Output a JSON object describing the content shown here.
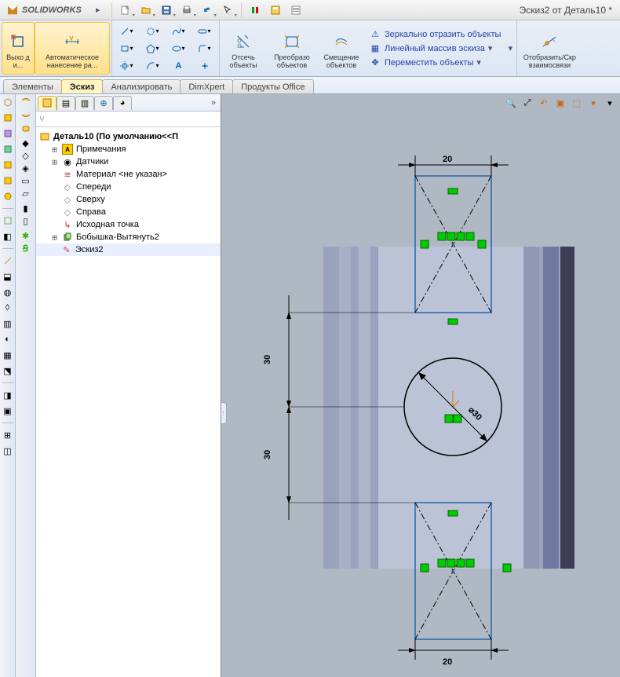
{
  "app": {
    "name": "SOLIDWORKS",
    "doc_title": "Эскиз2 от Деталь10 *"
  },
  "menubar": [
    {
      "id": "new",
      "name": "new-icon"
    },
    {
      "id": "open",
      "name": "open-icon"
    },
    {
      "id": "save",
      "name": "save-icon"
    },
    {
      "id": "print",
      "name": "print-icon"
    },
    {
      "id": "undo",
      "name": "undo-icon"
    },
    {
      "id": "select",
      "name": "select-arrow-icon"
    },
    {
      "id": "rebuild",
      "name": "rebuild-icon"
    },
    {
      "id": "options",
      "name": "options-icon"
    },
    {
      "id": "properties",
      "name": "properties-icon"
    }
  ],
  "ribbon": {
    "exit": {
      "label": "Выхо д и..."
    },
    "smart_dim": {
      "label": "Автоматическое нанесение ра..."
    },
    "sketch_icons": [
      "line",
      "arc",
      "polyline",
      "slot",
      "rect",
      "poly",
      "ellipse",
      "cut",
      "circle",
      "spline",
      "arc3",
      "radius",
      "pattern",
      "text",
      "point",
      "plane"
    ],
    "trim": {
      "label": "Отсечь объекты"
    },
    "convert": {
      "label": "Преобразо объектов"
    },
    "offset": {
      "label": "Смещение объектов"
    },
    "mirror": {
      "label": "Зеркально отразить объекты"
    },
    "linear": {
      "label": "Линейный массив эскиза"
    },
    "move": {
      "label": "Переместить объекты"
    },
    "relations": {
      "label": "Отобразить/Скр\nвзаимосвязи"
    }
  },
  "tabs": [
    "Элементы",
    "Эскиз",
    "Анализировать",
    "DimXpert",
    "Продукты Office"
  ],
  "active_tab": 1,
  "tree": {
    "title": "Деталь10  (По умолчанию<<П",
    "items": [
      {
        "id": "notes",
        "label": "Примечания",
        "icon": "notes-icon",
        "twist": "+"
      },
      {
        "id": "sensors",
        "label": "Датчики",
        "icon": "sensors-icon",
        "twist": "+"
      },
      {
        "id": "material",
        "label": "Материал <не указан>",
        "icon": "material-icon"
      },
      {
        "id": "front",
        "label": "Спереди",
        "icon": "plane-icon"
      },
      {
        "id": "top",
        "label": "Сверху",
        "icon": "plane-icon"
      },
      {
        "id": "right",
        "label": "Справа",
        "icon": "plane-icon"
      },
      {
        "id": "origin",
        "label": "Исходная точка",
        "icon": "origin-icon"
      },
      {
        "id": "boss",
        "label": "Бобышка-Вытянуть2",
        "icon": "extrude-icon",
        "twist": "+"
      },
      {
        "id": "sketch2",
        "label": "Эскиз2",
        "icon": "sketch-icon",
        "active": true
      }
    ]
  },
  "dimensions": {
    "top_width": "20",
    "bottom_width": "20",
    "upper_30": "30",
    "lower_30": "30",
    "diam": "30"
  }
}
